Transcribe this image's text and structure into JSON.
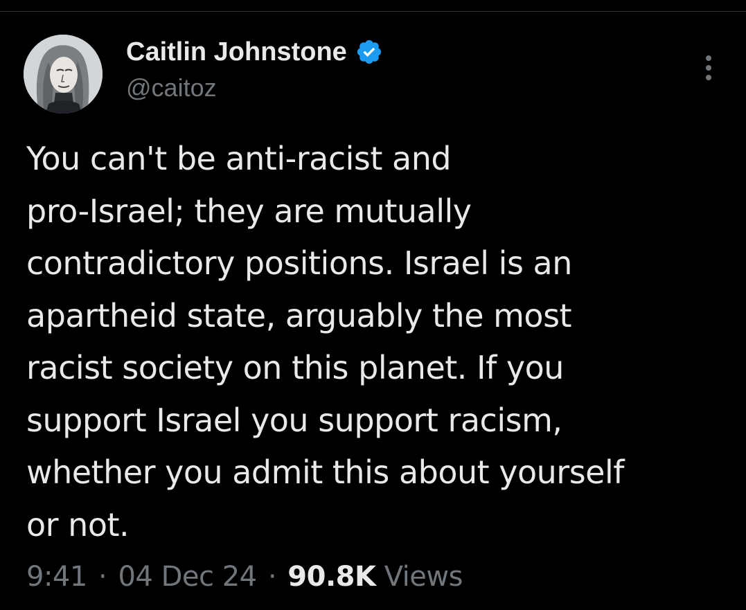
{
  "tweet": {
    "author": {
      "display_name": "Caitlin Johnstone",
      "handle": "@caitoz",
      "verified": true,
      "avatar_icon": "avatar-portrait"
    },
    "text": "You can't be anti-racist and\npro-Israel; they are mutually\ncontradictory positions. Israel is an\napartheid state, arguably the most\nracist society on this planet. If you\nsupport Israel you support racism,\nwhether you admit this about yourself\nor not.",
    "meta": {
      "time": "9:41",
      "date": "04 Dec 24",
      "separator": "·",
      "views_count": "90.8K",
      "views_label": "Views"
    }
  },
  "icons": {
    "verified": "verified-badge-icon",
    "more": "more-options-icon"
  },
  "colors": {
    "background": "#000000",
    "text_primary": "#e7e9ea",
    "text_secondary": "#71767b",
    "verified_blue": "#1d9bf0",
    "divider": "#2f3336"
  }
}
